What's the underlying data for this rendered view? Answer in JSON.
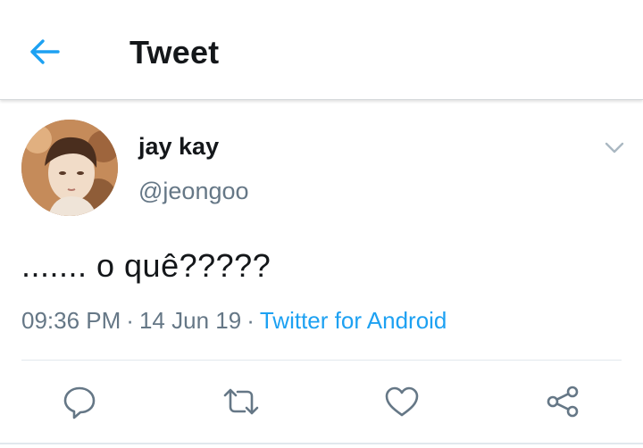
{
  "header": {
    "title": "Tweet",
    "back_icon": "back-arrow-icon"
  },
  "tweet": {
    "author": {
      "display_name": "jay kay",
      "handle": "@jeongoo"
    },
    "text": "....... o quê?????",
    "time": "09:36 PM",
    "separator": "·",
    "date": "14 Jun 19",
    "source": "Twitter for Android"
  },
  "actions": [
    {
      "name": "reply",
      "icon": "reply-icon"
    },
    {
      "name": "retweet",
      "icon": "retweet-icon"
    },
    {
      "name": "like",
      "icon": "heart-icon"
    },
    {
      "name": "share",
      "icon": "share-icon"
    }
  ],
  "colors": {
    "accent": "#1da1f2",
    "text": "#14171a",
    "secondary": "#657786",
    "divider": "#e1e8ed"
  }
}
